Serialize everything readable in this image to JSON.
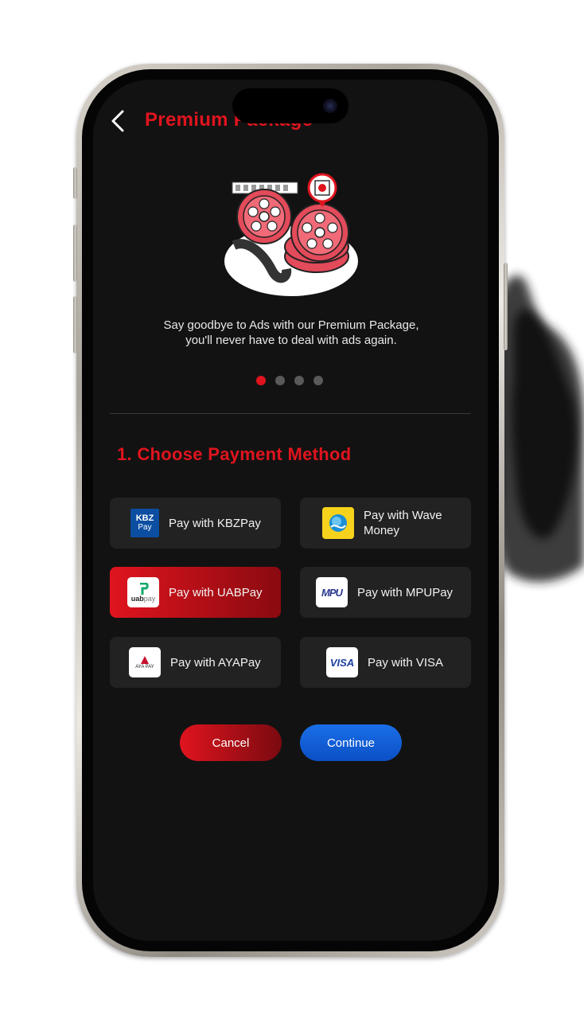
{
  "header": {
    "title": "Premium Package"
  },
  "intro": {
    "description_line1": "Say goodbye to Ads with our Premium Package,",
    "description_line2": "you'll never have to deal with ads again.",
    "carousel_pages": 4,
    "carousel_active": 1
  },
  "payment": {
    "section_title": "1. Choose Payment Method",
    "methods": [
      {
        "label": "Pay with KBZPay",
        "logo_text_top": "KBZ",
        "logo_text_bottom": "Pay",
        "icon": "kbzpay-logo-icon",
        "selected": false
      },
      {
        "label": "Pay with Wave Money",
        "icon": "wave-money-logo-icon",
        "selected": false
      },
      {
        "label": "Pay with UABPay",
        "logo_text": "uab",
        "logo_text_small": "pay",
        "icon": "uabpay-logo-icon",
        "selected": true
      },
      {
        "label": "Pay with MPUPay",
        "logo_text": "MPU",
        "icon": "mpu-logo-icon",
        "selected": false
      },
      {
        "label": "Pay with AYAPay",
        "logo_text": "AYA PAY",
        "icon": "ayapay-logo-icon",
        "selected": false
      },
      {
        "label": "Pay with VISA",
        "logo_text": "VISA",
        "icon": "visa-logo-icon",
        "selected": false
      }
    ]
  },
  "actions": {
    "cancel_label": "Cancel",
    "continue_label": "Continue"
  },
  "colors": {
    "accent": "#e0141e",
    "primary_blue": "#1a6fe8",
    "background": "#121212",
    "card": "#222222"
  }
}
